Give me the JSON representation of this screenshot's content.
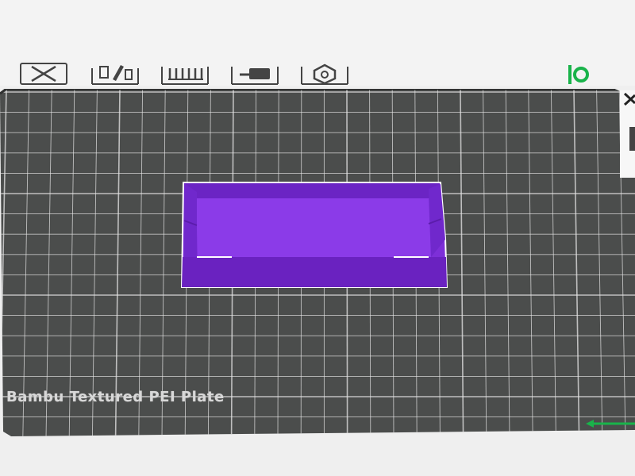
{
  "toolbar": {
    "items": [
      {
        "name": "delete",
        "icon": "delete-x-icon"
      },
      {
        "name": "paint",
        "icon": "paint-brush-icon"
      },
      {
        "name": "fuzzy-skin",
        "icon": "comb-icon"
      },
      {
        "name": "cut",
        "icon": "cut-plate-icon"
      },
      {
        "name": "settings",
        "icon": "hex-nut-icon"
      }
    ]
  },
  "axis_indicator": {
    "icon": "axis-orientation-icon",
    "color": "#19b34a"
  },
  "plate": {
    "label": "Bambu Textured PEI Plate",
    "surface_color": "#4b4d4c",
    "grid_color": "#e6e6e6"
  },
  "model": {
    "color": "#8b3be8",
    "selected": true,
    "outline_color": "#ffffff"
  },
  "colors": {
    "x_axis": "#19b34a",
    "toolbar_icon": "#444444"
  }
}
